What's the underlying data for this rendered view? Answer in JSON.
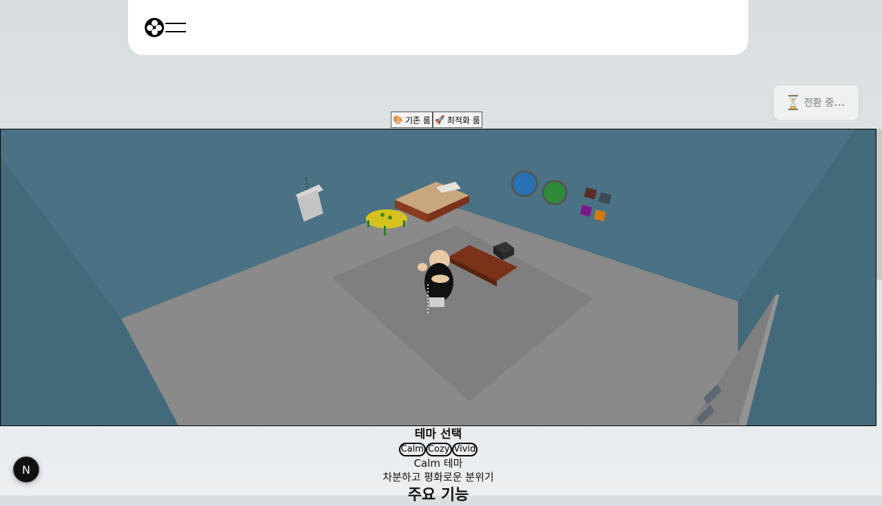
{
  "header": {
    "logo_icon": "flower-logo-icon",
    "menu_icon": "hamburger-menu-icon"
  },
  "toast": {
    "icon": "hourglass-icon",
    "text": "전환 중..."
  },
  "room_tabs": [
    {
      "icon": "palette-icon",
      "emoji": "🎨",
      "label": "기존 룸"
    },
    {
      "icon": "rocket-icon",
      "emoji": "🚀",
      "label": "최적화 룸"
    }
  ],
  "scene": {
    "colors": {
      "wall": "#4a7284",
      "floor": "#8a8a8a",
      "rug": "#7f7f7f"
    }
  },
  "theme": {
    "title": "테마 선택",
    "options": [
      "Calm",
      "Cozy",
      "Vivid"
    ],
    "selected_name": "Calm 테마",
    "description": "차분하고 평화로운 분위기"
  },
  "features": {
    "heading": "주요 기능"
  },
  "badge": {
    "letter": "N"
  }
}
